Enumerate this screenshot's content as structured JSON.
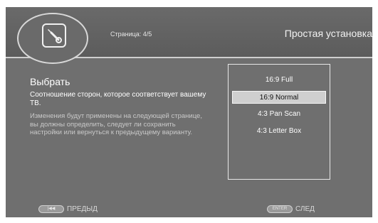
{
  "header": {
    "page_indicator": "Страница: 4/5",
    "title": "Простая установка",
    "logo_icon": "wrench-icon"
  },
  "main": {
    "heading": "Выбрать",
    "description": "Соотношение сторон, которое соответствует вашему ТВ.",
    "note": "Изменения будут применены на следующей странице, вы должны определить, следует ли сохранить настройки или вернуться к предыдущему варианту."
  },
  "options": {
    "selected_index": 1,
    "items": [
      {
        "label": "16:9 Full"
      },
      {
        "label": "16:9 Normal"
      },
      {
        "label": "4:3 Pan Scan"
      },
      {
        "label": "4:3 Letter Box"
      }
    ]
  },
  "footer": {
    "back_button_glyph": "|◀◀",
    "back_label": "ПРЕДЫД",
    "next_button_glyph": "ENTER",
    "next_label": "СЛЕД"
  },
  "colors": {
    "background": "#6f6f6f",
    "selection": "#cfcfcf",
    "text": "#ffffff"
  }
}
